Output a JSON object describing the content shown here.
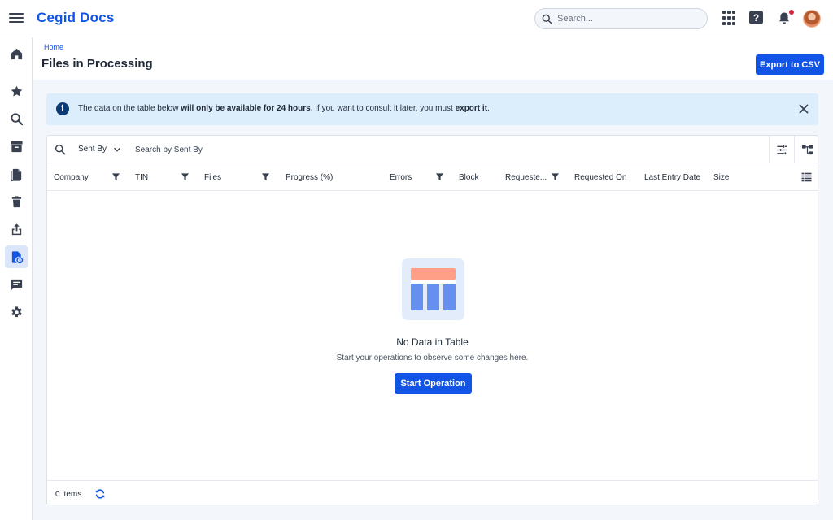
{
  "app": {
    "title": "Cegid Docs"
  },
  "header": {
    "search_placeholder": "Search...",
    "icons": [
      "menu-icon",
      "apps-grid-icon",
      "help-icon",
      "bell-icon",
      "avatar"
    ],
    "help_glyph": "?"
  },
  "sidebar": {
    "items": [
      {
        "name": "home",
        "icon": "home-icon",
        "active": false
      },
      {
        "name": "favorites",
        "icon": "star-icon",
        "active": false
      },
      {
        "name": "search",
        "icon": "search-icon",
        "active": false
      },
      {
        "name": "archive",
        "icon": "archive-icon",
        "active": false
      },
      {
        "name": "documents",
        "icon": "documents-icon",
        "active": false
      },
      {
        "name": "trash",
        "icon": "trash-icon",
        "active": false
      },
      {
        "name": "share",
        "icon": "share-icon",
        "active": false
      },
      {
        "name": "files-processing",
        "icon": "file-processing-icon",
        "active": true
      },
      {
        "name": "messages",
        "icon": "message-icon",
        "active": false
      },
      {
        "name": "settings",
        "icon": "gear-icon",
        "active": false
      }
    ]
  },
  "page": {
    "breadcrumb": "Home",
    "title": "Files in Processing",
    "export_label": "Export to CSV"
  },
  "banner": {
    "info_glyph": "i",
    "text_1": "The data on the table below ",
    "text_bold_1": "will only be available for 24 hours",
    "text_2": ". If you want to consult it later, you must ",
    "text_bold_2": "export it",
    "text_3": "."
  },
  "table": {
    "search_field": "Sent By",
    "search_placeholder": "Search by Sent By",
    "columns": [
      {
        "label": "Company",
        "filter": true
      },
      {
        "label": "TIN",
        "filter": true
      },
      {
        "label": "Files",
        "filter": true
      },
      {
        "label": "Progress (%)",
        "filter": false
      },
      {
        "label": "Errors",
        "filter": true
      },
      {
        "label": "Block",
        "filter": false
      },
      {
        "label": "Requeste...",
        "filter": true
      },
      {
        "label": "Requested On",
        "filter": false
      },
      {
        "label": "Last Entry Date",
        "filter": false
      },
      {
        "label": "Size",
        "filter": false
      }
    ],
    "empty_title": "No Data in Table",
    "empty_subtitle": "Start your operations to observe some changes here.",
    "start_label": "Start Operation",
    "items_count": "0 items"
  },
  "colors": {
    "brand": "#1154e6",
    "banner_bg": "#dceefb",
    "active_nav_bg": "#dbe6fb",
    "illustration_header": "#ff9f87",
    "illustration_bars": "#6690f0"
  }
}
